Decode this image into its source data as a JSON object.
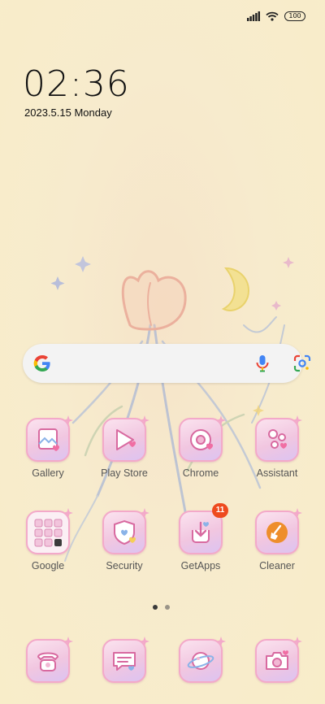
{
  "status_bar": {
    "battery": "100",
    "icons": [
      "signal-icon",
      "wifi-icon",
      "battery-icon"
    ]
  },
  "lock": {
    "time": "02:36",
    "date": "2023.5.15 Monday"
  },
  "search": {
    "icons": [
      "google-logo-icon",
      "microphone-icon",
      "google-lens-icon"
    ]
  },
  "apps_row1": [
    {
      "label": "Gallery",
      "icon": "gallery-icon"
    },
    {
      "label": "Play Store",
      "icon": "play-store-icon"
    },
    {
      "label": "Chrome",
      "icon": "chrome-icon"
    },
    {
      "label": "Assistant",
      "icon": "assistant-icon"
    }
  ],
  "apps_row2": [
    {
      "label": "Google",
      "icon": "google-folder-icon"
    },
    {
      "label": "Security",
      "icon": "security-icon"
    },
    {
      "label": "GetApps",
      "icon": "getapps-icon",
      "badge": "11"
    },
    {
      "label": "Cleaner",
      "icon": "cleaner-icon"
    }
  ],
  "dock": [
    {
      "icon": "phone-icon"
    },
    {
      "icon": "messages-icon"
    },
    {
      "icon": "browser-icon"
    },
    {
      "icon": "camera-icon"
    }
  ],
  "pager": {
    "pages": 2,
    "active": 1
  },
  "colors": {
    "accent_pink": "#f3a9c9",
    "badge": "#ee4a1e",
    "wallpaper": "#f8edc9"
  }
}
